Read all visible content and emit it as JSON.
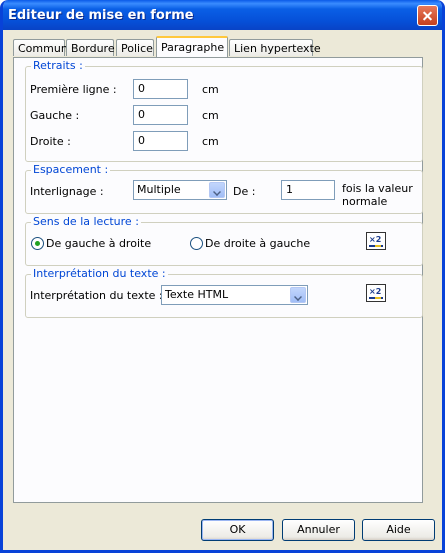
{
  "window": {
    "title": "Editeur de mise en forme"
  },
  "tabs": [
    "Commun",
    "Bordure",
    "Police",
    "Paragraphe",
    "Lien hypertexte"
  ],
  "retraits": {
    "legend": "Retraits :",
    "premiere_label": "Première ligne :",
    "premiere_value": "0",
    "gauche_label": "Gauche :",
    "gauche_value": "0",
    "droite_label": "Droite :",
    "droite_value": "0",
    "unit": "cm"
  },
  "espacement": {
    "legend": "Espacement :",
    "interligne_label": "Interlignage :",
    "interligne_value": "Multiple",
    "de_label": "De :",
    "de_value": "1",
    "suffix_line1": "fois la valeur",
    "suffix_line2": "normale"
  },
  "sens": {
    "legend": "Sens de la lecture :",
    "ltr_label": "De gauche à droite",
    "rtl_label": "De droite à gauche",
    "selected": "ltr"
  },
  "interpretation": {
    "legend": "Interprétation du texte :",
    "label": "Interprétation du texte :",
    "value": "Texte HTML"
  },
  "buttons": {
    "ok": "OK",
    "cancel": "Annuler",
    "help": "Aide"
  },
  "colors": {
    "title_bar": "#0a5fe6",
    "legend_text": "#0046d5",
    "tab_highlight": "#ffc83c"
  },
  "icons": {
    "close": "close-icon",
    "toggle": "x2-toggle-icon"
  }
}
